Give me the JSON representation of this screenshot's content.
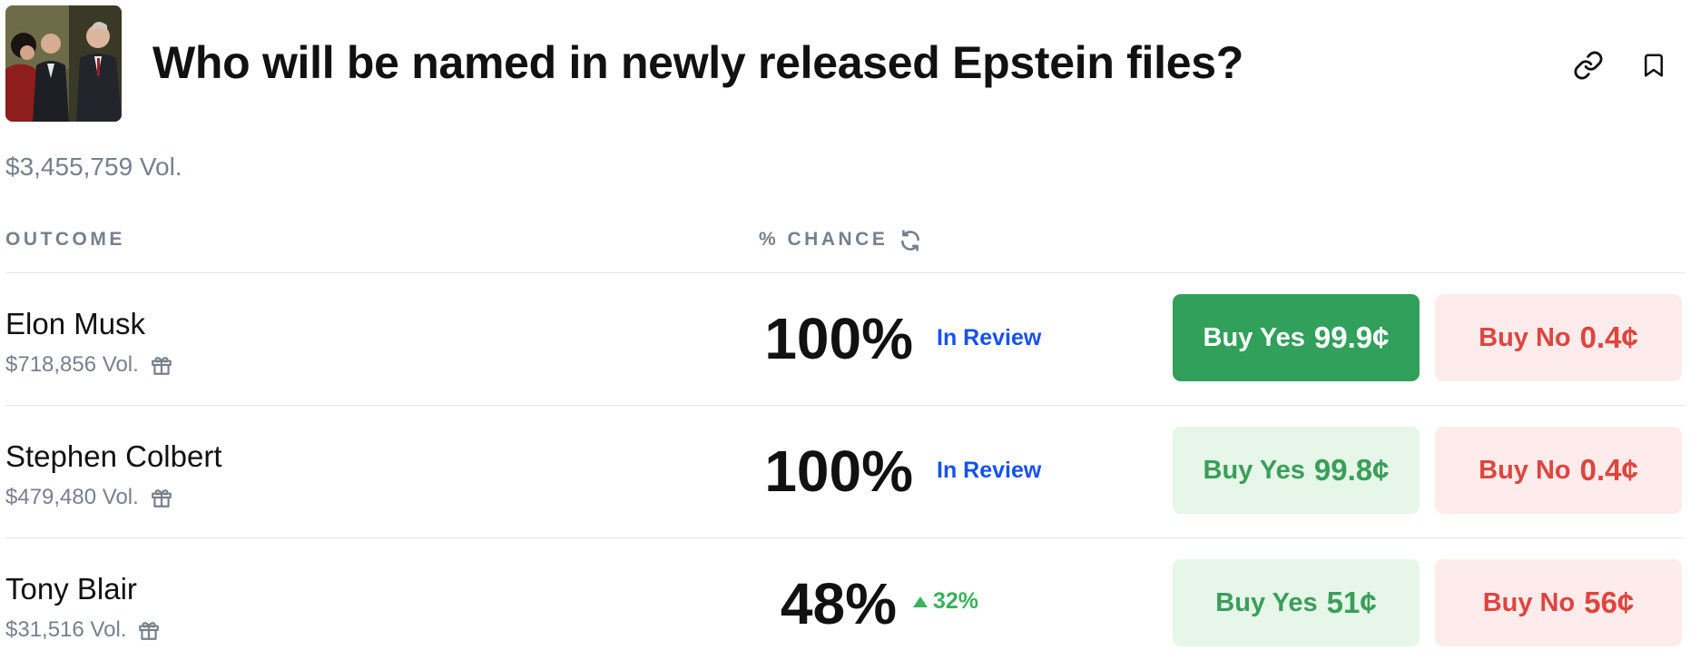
{
  "market": {
    "title": "Who will be named in newly released Epstein files?",
    "volume": "$3,455,759 Vol."
  },
  "table": {
    "col_outcome": "OUTCOME",
    "col_chance": "% CHANCE"
  },
  "outcomes": [
    {
      "name": "Elon Musk",
      "volume": "$718,856 Vol.",
      "chance": "100%",
      "status": "In Review",
      "yes_label": "Buy Yes",
      "yes_price": "99.9¢",
      "no_label": "Buy No",
      "no_price": "0.4¢"
    },
    {
      "name": "Stephen Colbert",
      "volume": "$479,480 Vol.",
      "chance": "100%",
      "status": "In Review",
      "yes_label": "Buy Yes",
      "yes_price": "99.8¢",
      "no_label": "Buy No",
      "no_price": "0.4¢"
    },
    {
      "name": "Tony Blair",
      "volume": "$31,516 Vol.",
      "chance": "48%",
      "delta": "32%",
      "yes_label": "Buy Yes",
      "yes_price": "51¢",
      "no_label": "Buy No",
      "no_price": "56¢"
    }
  ],
  "colors": {
    "yes_active": "#31a05b",
    "yes_soft": "#e6f6e9",
    "no_soft": "#fdeceb",
    "status_blue": "#1452f0",
    "delta_green": "#3bb15d"
  },
  "icons": [
    "link-icon",
    "bookmark-icon",
    "refresh-icon",
    "gift-icon",
    "up-arrow-icon"
  ]
}
